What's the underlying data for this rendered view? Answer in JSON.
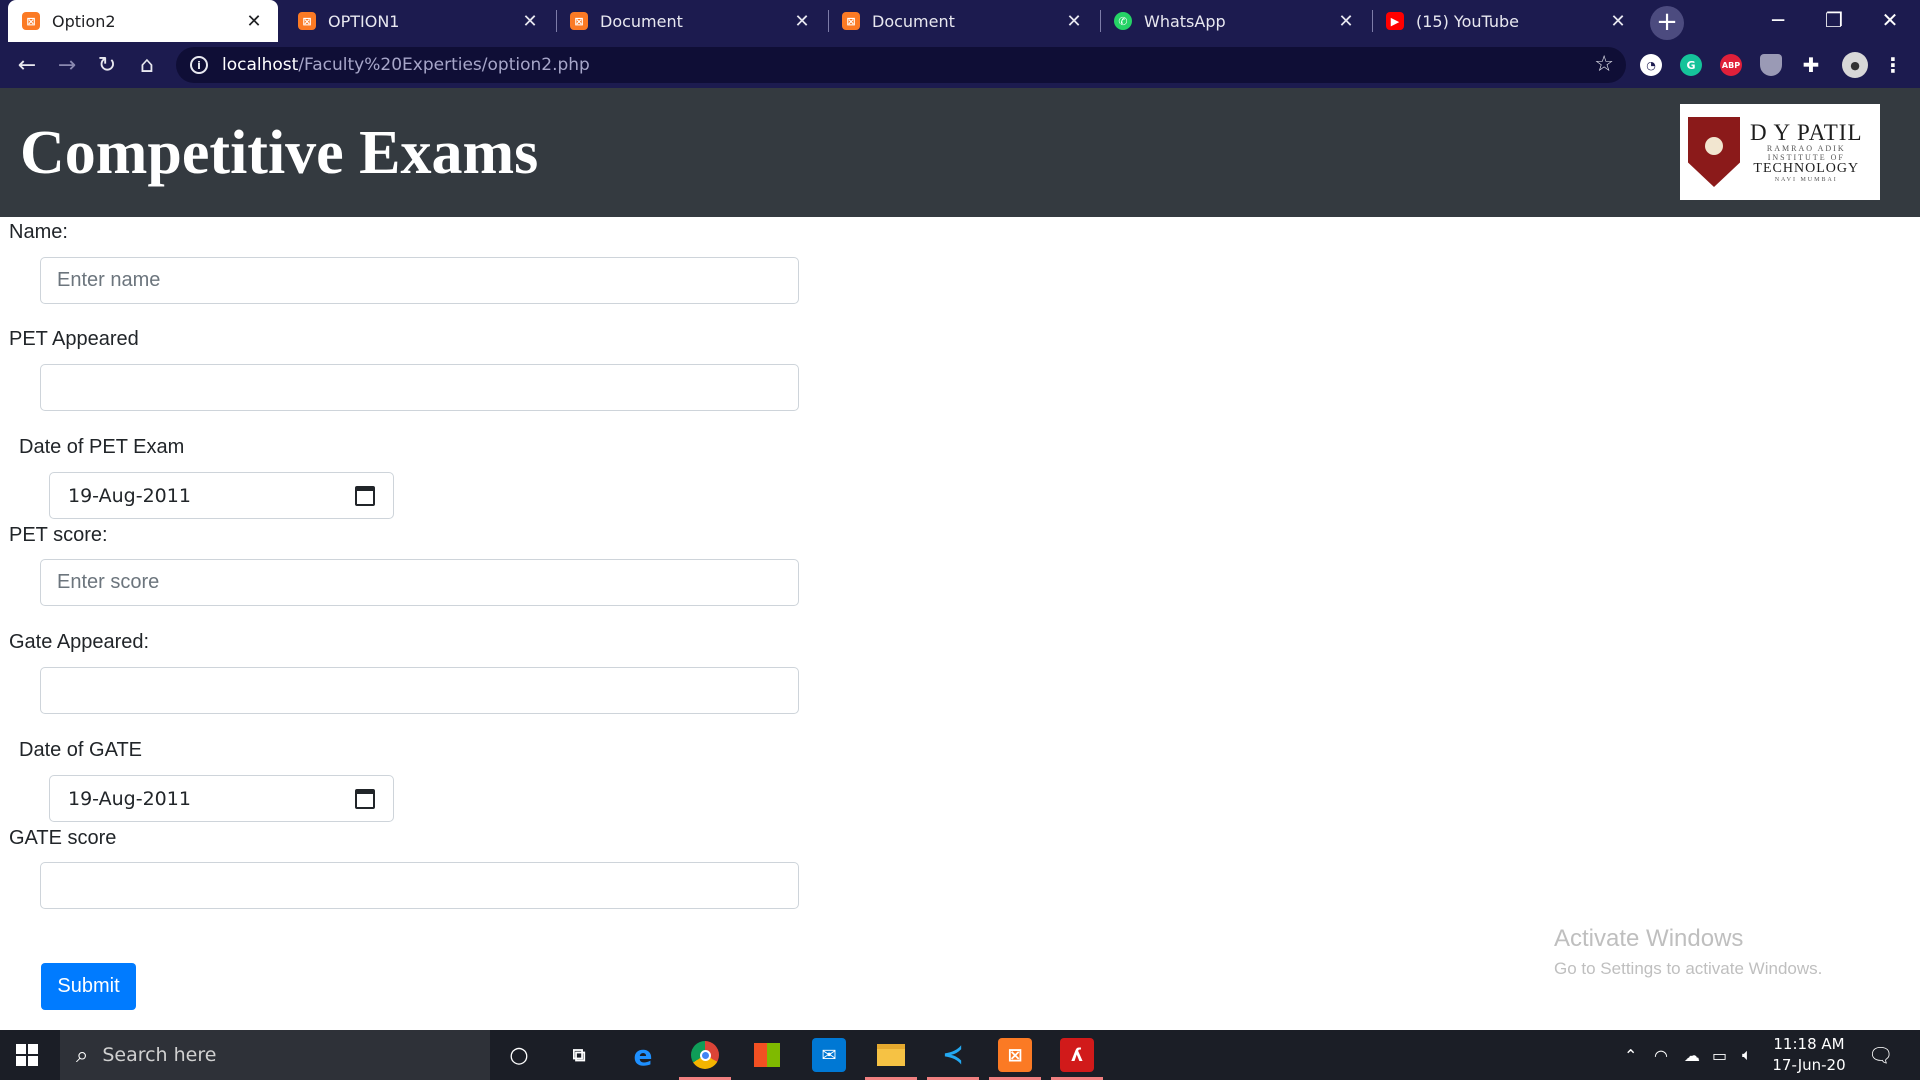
{
  "browser": {
    "tabs": [
      {
        "title": "Option2",
        "favicon": "xampp-icon",
        "active": true
      },
      {
        "title": "OPTION1",
        "favicon": "xampp-icon",
        "active": false
      },
      {
        "title": "Document",
        "favicon": "xampp-icon",
        "active": false
      },
      {
        "title": "Document",
        "favicon": "xampp-icon",
        "active": false
      },
      {
        "title": "WhatsApp",
        "favicon": "whatsapp-icon",
        "active": false
      },
      {
        "title": "(15) YouTube",
        "favicon": "youtube-icon",
        "active": false
      }
    ],
    "url_host": "localhost",
    "url_path": "/Faculty%20Experties/option2.php"
  },
  "page": {
    "title": "Competitive Exams",
    "logo": {
      "line1": "D Y PATIL",
      "line2": "RAMRAO ADIK",
      "line3": "INSTITUTE OF",
      "line4": "TECHNOLOGY",
      "line5": "NAVI MUMBAI"
    }
  },
  "form": {
    "name_label": "Name:",
    "name_placeholder": "Enter name",
    "pet_appeared_label": "PET Appeared",
    "pet_date_label": "Date of PET Exam",
    "pet_date_value": "19-Aug-2011",
    "pet_score_label": "PET score:",
    "pet_score_placeholder": "Enter score",
    "gate_appeared_label": "Gate Appeared:",
    "gate_date_label": "Date of GATE",
    "gate_date_value": "19-Aug-2011",
    "gate_score_label": "GATE score",
    "submit_label": "Submit"
  },
  "watermark": {
    "line1": "Activate Windows",
    "line2": "Go to Settings to activate Windows."
  },
  "taskbar": {
    "search_placeholder": "Search here",
    "time": "11:18 AM",
    "date": "17-Jun-20"
  },
  "colors": {
    "header_bg": "#343a40",
    "primary": "#007bff",
    "browser_frame": "#1c1b4f"
  }
}
